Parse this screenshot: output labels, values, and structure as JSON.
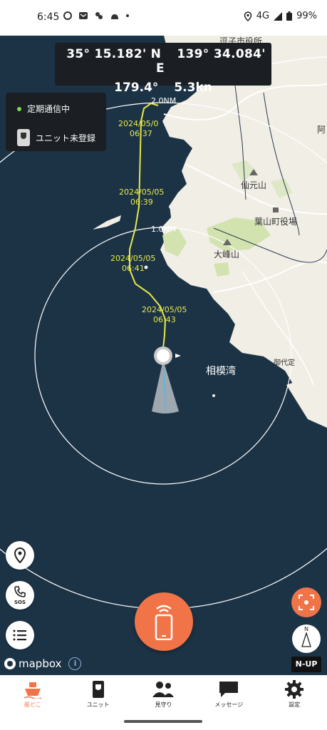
{
  "status_bar": {
    "time": "6:45",
    "network": "4G",
    "battery": "99%"
  },
  "header": {
    "latitude": "35° 15.182' N",
    "longitude": "139° 34.084' E",
    "heading": "179.4°",
    "speed": "5.3kn"
  },
  "status_panel": {
    "comm_status": "定期通信中",
    "unit_status": "ユニット未登録"
  },
  "map": {
    "range_labels": [
      "2.0NM",
      "1.0NM"
    ],
    "track_points": [
      {
        "date": "2024/05/0",
        "time": "06:37"
      },
      {
        "date": "2024/05/05",
        "time": "06:39"
      },
      {
        "date": "2024/05/05",
        "time": "06:41"
      },
      {
        "date": "2024/05/05",
        "time": "06:43"
      }
    ],
    "places": {
      "north_city": "逗子市役所",
      "mountain1": "仙元山",
      "townhall": "葉山町役場",
      "mountain2": "大峰山",
      "bay": "相模湾",
      "cape": "御代定",
      "edge": "阿"
    }
  },
  "controls": {
    "sos_label": "SOS",
    "north_label": "N",
    "nup_label": "N-UP",
    "attribution": "mapbox",
    "info_label": "i"
  },
  "nav": {
    "items": [
      {
        "label": "船どこ",
        "active": true
      },
      {
        "label": "ユニット"
      },
      {
        "label": "見守り"
      },
      {
        "label": "メッセージ"
      },
      {
        "label": "設定"
      }
    ]
  },
  "colors": {
    "accent": "#f07447",
    "sea": "#1c3346",
    "land": "#f1eee5",
    "track": "#e6e84a",
    "comm_ok": "#7ed957"
  }
}
